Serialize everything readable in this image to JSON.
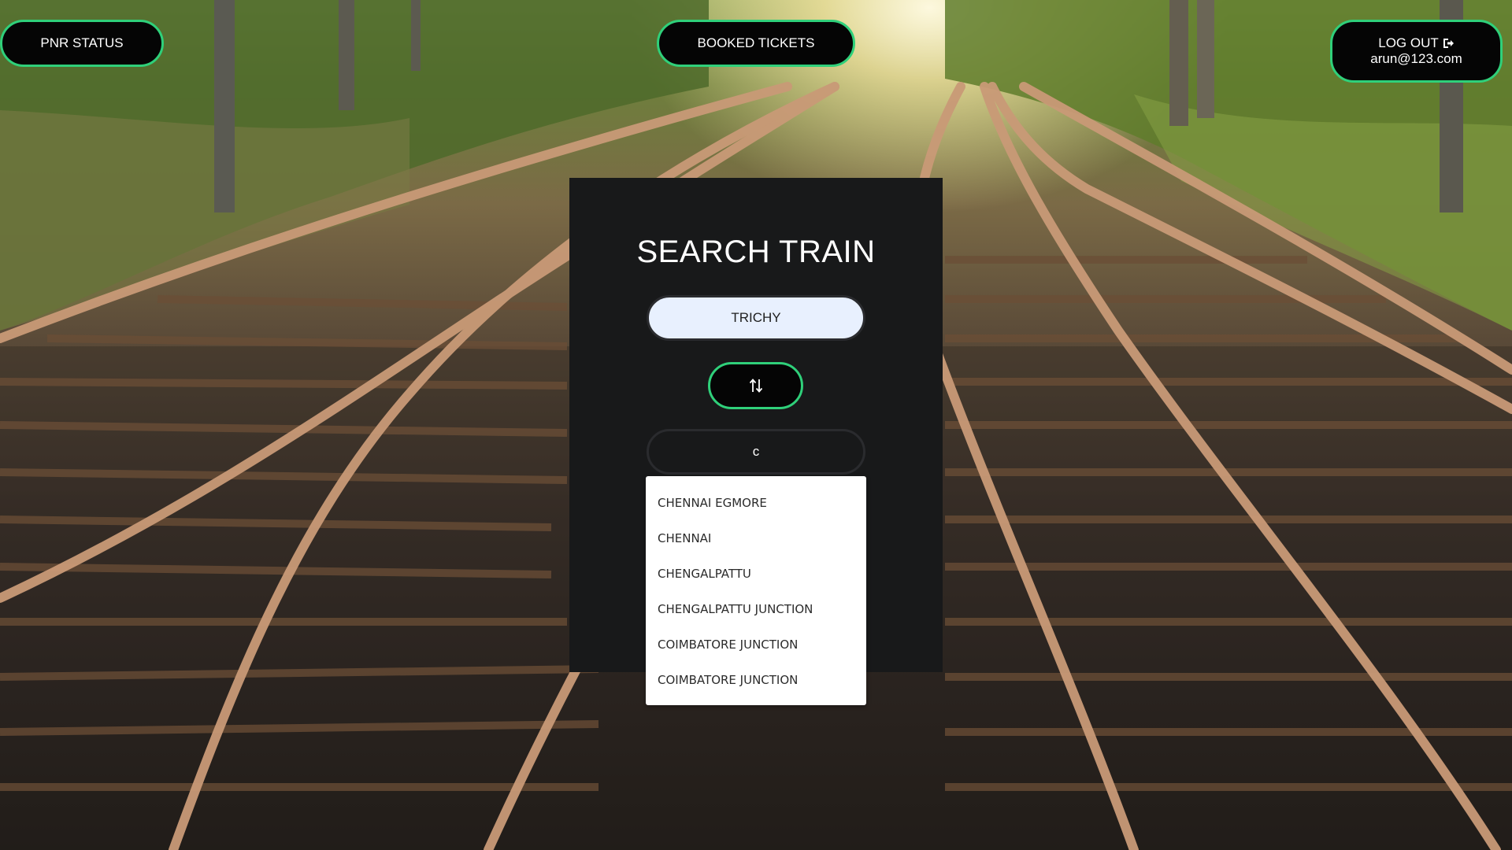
{
  "nav": {
    "pnr_status_label": "PNR STATUS",
    "booked_tickets_label": "BOOKED TICKETS",
    "logout_label": "LOG OUT",
    "logout_icon": "sign-out-icon",
    "user_email": "arun@123.com"
  },
  "search": {
    "title": "SEARCH TRAIN",
    "from_value": "TRICHY",
    "swap_icon": "swap-vertical-icon",
    "to_value": "c"
  },
  "suggestions": [
    "CHENNAI EGMORE",
    "CHENNAI",
    "CHENGALPATTU",
    "CHENGALPATTU JUNCTION",
    "COIMBATORE JUNCTION",
    "COIMBATORE JUNCTION"
  ],
  "colors": {
    "accent_border": "#2fd07a",
    "button_bg": "#050505",
    "panel_bg": "#18191a",
    "from_input_bg": "#e8f0fe",
    "dropdown_bg": "#ffffff"
  }
}
